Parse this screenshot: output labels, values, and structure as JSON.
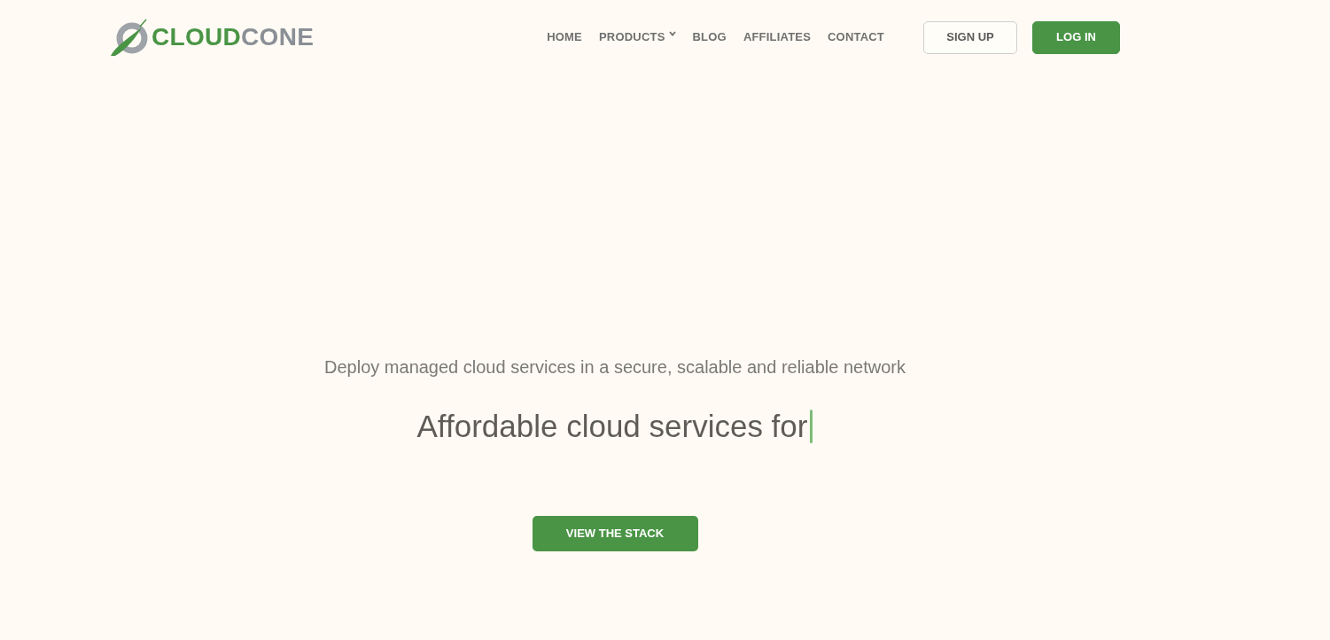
{
  "header": {
    "logo": {
      "primary": "CLOUD",
      "secondary": "CONE"
    },
    "nav": [
      {
        "label": "HOME",
        "kind": "link"
      },
      {
        "label": "PRODUCTS",
        "kind": "dropdown"
      },
      {
        "label": "BLOG",
        "kind": "link"
      },
      {
        "label": "AFFILIATES",
        "kind": "link"
      },
      {
        "label": "CONTACT",
        "kind": "link"
      }
    ],
    "buttons": [
      {
        "label": "SIGN UP",
        "kind": "outline"
      },
      {
        "label": "LOG IN",
        "kind": "primary"
      }
    ]
  },
  "hero": {
    "subtitle": "Deploy managed cloud services in a secure, scalable and reliable network",
    "headline": "Affordable cloud services for",
    "cursor_visible": true,
    "button": "VIEW THE STACK"
  }
}
